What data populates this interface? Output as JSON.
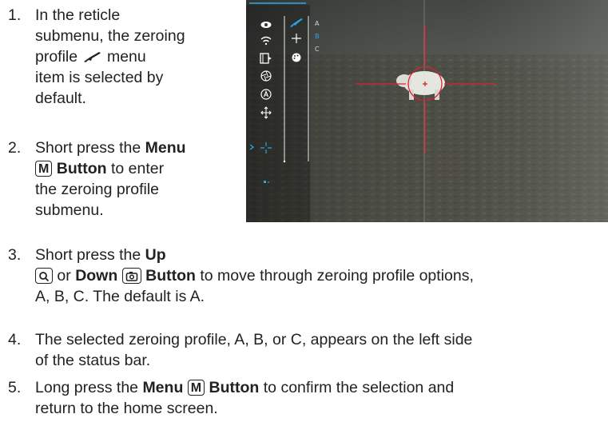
{
  "steps": [
    {
      "n": "1.",
      "a": "In the reticle",
      "b": "submenu, the zeroing",
      "c1": "profile",
      "c2": "menu",
      "d": "item is selected by",
      "e": "default."
    },
    {
      "n": "2.",
      "a1": "Short press the",
      "a2": "Menu",
      "b1": "M",
      "b2": "Button",
      "b3": "to enter",
      "c": "the zeroing profile",
      "d": "submenu."
    },
    {
      "n": "3.",
      "a1": "Short press the",
      "a2": "Up",
      "b2": "or",
      "b3": "Down",
      "b4": "Button",
      "b5": "to move through zeroing profile options,",
      "c": "A, B, C. The default is A."
    },
    {
      "n": "4.",
      "a": "The selected zeroing profile, A, B, or C, appears on the left side",
      "b": "of the status bar."
    },
    {
      "n": "5.",
      "a1": "Long press the",
      "a2": "Menu",
      "a3": "M",
      "a4": "Button",
      "a5": "to confirm the selection and",
      "b": "return to the home screen."
    }
  ],
  "screen": {
    "profiles": [
      "A",
      "B",
      "C"
    ],
    "selected_profile": "B",
    "icons": [
      "eye-icon",
      "wifi-icon",
      "video-icon",
      "aperture-icon",
      "auto-icon",
      "move-icon",
      "reticle-icon"
    ],
    "submenu_icons": [
      "rifle-icon",
      "crosshair-icon",
      "palette-icon"
    ],
    "colors": {
      "reticle": "#e0202c",
      "highlight": "#2aa7e8"
    }
  }
}
